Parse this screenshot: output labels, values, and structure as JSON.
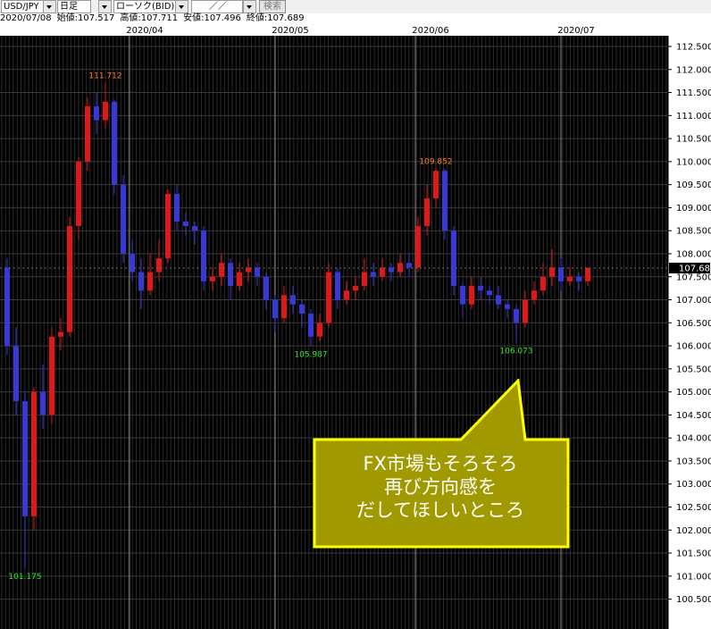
{
  "toolbar": {
    "pair": "USD/JPY",
    "timeframe": "日足",
    "chart_style": "ローソク(BID)",
    "date_field": "／／",
    "search_button": "検索"
  },
  "info": {
    "date": "2020/07/08",
    "open": "始値:107.517",
    "high": "高値:107.711",
    "low": "安値:107.496",
    "close": "終値:107.689"
  },
  "callout": {
    "line1": "FX市場もそろそろ",
    "line2": "再び方向感を",
    "line3": "だしてほしいところ"
  },
  "colors": {
    "background": "#000000",
    "bull": "#e01818",
    "bear": "#3838d8",
    "callout_fill": "#a09a00",
    "callout_border": "#ffff00"
  },
  "chart_data": {
    "type": "candlestick",
    "x_tick_labels": [
      "2020/04",
      "2020/05",
      "2020/06",
      "2020/07"
    ],
    "y_ticks": [
      "100.500",
      "101.000",
      "101.500",
      "102.000",
      "102.500",
      "103.000",
      "103.500",
      "104.000",
      "104.500",
      "105.000",
      "105.500",
      "106.000",
      "106.500",
      "107.000",
      "107.500",
      "108.000",
      "108.500",
      "109.000",
      "109.500",
      "110.000",
      "110.500",
      "111.000",
      "111.500",
      "112.000",
      "112.500"
    ],
    "ylim": [
      100.2,
      112.75
    ],
    "last_price": "107.689",
    "annotations": [
      {
        "label": "111.712",
        "kind": "high"
      },
      {
        "label": "101.175",
        "kind": "low"
      },
      {
        "label": "105.987",
        "kind": "low"
      },
      {
        "label": "109.852",
        "kind": "high"
      },
      {
        "label": "106.073",
        "kind": "low"
      }
    ],
    "candles": [
      [
        107.7,
        106.0,
        107.9,
        105.8
      ],
      [
        106.0,
        104.8,
        106.4,
        104.5
      ],
      [
        104.8,
        102.3,
        105.0,
        101.175
      ],
      [
        102.3,
        105.0,
        105.1,
        102.0
      ],
      [
        105.0,
        104.5,
        105.6,
        104.2
      ],
      [
        104.5,
        106.2,
        106.4,
        104.3
      ],
      [
        106.2,
        106.3,
        106.6,
        105.9
      ],
      [
        106.3,
        108.6,
        108.8,
        106.2
      ],
      [
        108.6,
        110.0,
        110.1,
        108.3
      ],
      [
        110.0,
        111.2,
        111.4,
        109.8
      ],
      [
        111.2,
        110.9,
        111.5,
        110.6
      ],
      [
        110.9,
        111.3,
        111.712,
        110.7
      ],
      [
        111.3,
        109.5,
        111.35,
        109.3
      ],
      [
        109.5,
        108.0,
        109.7,
        107.8
      ],
      [
        108.0,
        107.6,
        108.3,
        107.4
      ],
      [
        107.6,
        107.2,
        107.9,
        106.8
      ],
      [
        107.2,
        107.6,
        108.0,
        107.1
      ],
      [
        107.6,
        107.9,
        108.3,
        107.4
      ],
      [
        107.9,
        109.3,
        109.4,
        107.8
      ],
      [
        109.3,
        108.7,
        109.5,
        108.5
      ],
      [
        108.7,
        108.6,
        108.9,
        108.4
      ],
      [
        108.6,
        108.5,
        108.7,
        108.2
      ],
      [
        108.5,
        107.4,
        108.6,
        107.2
      ],
      [
        107.4,
        107.5,
        107.7,
        107.2
      ],
      [
        107.5,
        107.8,
        108.0,
        107.3
      ],
      [
        107.8,
        107.3,
        107.9,
        107.0
      ],
      [
        107.3,
        107.6,
        107.8,
        107.2
      ],
      [
        107.6,
        107.7,
        107.9,
        107.4
      ],
      [
        107.7,
        107.5,
        107.8,
        107.3
      ],
      [
        107.5,
        107.0,
        107.6,
        106.8
      ],
      [
        107.0,
        106.6,
        107.1,
        106.3
      ],
      [
        106.6,
        107.1,
        107.3,
        106.5
      ],
      [
        107.1,
        106.9,
        107.3,
        106.7
      ],
      [
        106.9,
        106.7,
        107.0,
        106.4
      ],
      [
        106.7,
        106.2,
        106.8,
        105.987
      ],
      [
        106.2,
        106.5,
        106.7,
        106.1
      ],
      [
        106.5,
        107.6,
        107.8,
        106.4
      ],
      [
        107.6,
        107.0,
        107.7,
        106.8
      ],
      [
        107.0,
        107.2,
        107.4,
        106.9
      ],
      [
        107.2,
        107.3,
        107.5,
        107.0
      ],
      [
        107.3,
        107.6,
        107.9,
        107.2
      ],
      [
        107.6,
        107.5,
        107.8,
        107.3
      ],
      [
        107.5,
        107.7,
        107.9,
        107.4
      ],
      [
        107.7,
        107.6,
        107.8,
        107.4
      ],
      [
        107.6,
        107.8,
        108.0,
        107.5
      ],
      [
        107.8,
        107.7,
        108.0,
        107.5
      ],
      [
        107.7,
        108.6,
        108.8,
        107.6
      ],
      [
        108.6,
        109.2,
        109.5,
        108.4
      ],
      [
        109.2,
        109.8,
        109.852,
        109.0
      ],
      [
        109.8,
        108.5,
        109.85,
        108.3
      ],
      [
        108.5,
        107.3,
        108.6,
        107.1
      ],
      [
        107.3,
        106.9,
        107.4,
        106.6
      ],
      [
        106.9,
        107.3,
        107.5,
        106.8
      ],
      [
        107.3,
        107.2,
        107.5,
        107.0
      ],
      [
        107.2,
        107.1,
        107.3,
        106.9
      ],
      [
        107.1,
        106.9,
        107.3,
        106.8
      ],
      [
        106.9,
        106.8,
        107.0,
        106.6
      ],
      [
        106.8,
        106.5,
        106.9,
        106.073
      ],
      [
        106.5,
        107.0,
        107.2,
        106.4
      ],
      [
        107.0,
        107.2,
        107.4,
        106.9
      ],
      [
        107.2,
        107.5,
        107.8,
        107.1
      ],
      [
        107.5,
        107.7,
        108.1,
        107.3
      ],
      [
        107.7,
        107.4,
        107.9,
        107.2
      ],
      [
        107.4,
        107.5,
        107.7,
        107.3
      ],
      [
        107.5,
        107.4,
        107.6,
        107.2
      ],
      [
        107.4,
        107.689,
        107.711,
        107.3
      ]
    ]
  }
}
